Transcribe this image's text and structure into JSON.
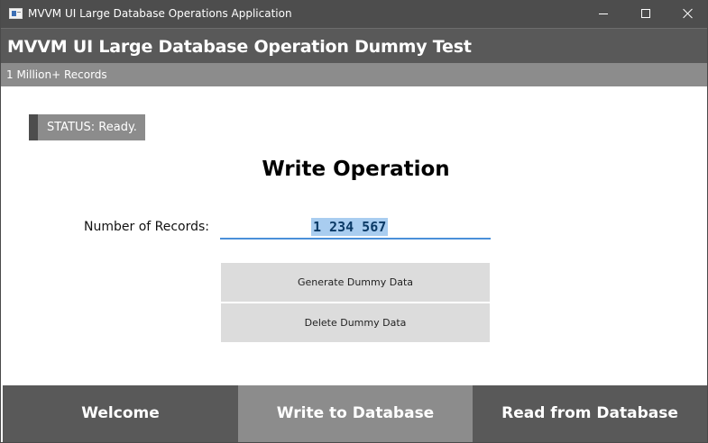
{
  "window": {
    "title": "MVVM UI Large Database Operations Application",
    "controls": {
      "minimize_icon": "minimize-icon",
      "maximize_icon": "maximize-icon",
      "close_icon": "close-icon"
    }
  },
  "header": {
    "title": "MVVM UI Large Database Operation Dummy Test",
    "subtitle": "1 Million+ Records"
  },
  "status": {
    "text": "STATUS: Ready."
  },
  "main": {
    "section_title": "Write Operation",
    "records_label": "Number of Records:",
    "records_value": "1 234 567",
    "generate_label": "Generate Dummy Data",
    "delete_label": "Delete Dummy Data"
  },
  "nav": {
    "items": [
      {
        "label": "Welcome",
        "active": false
      },
      {
        "label": "Write to Database",
        "active": true
      },
      {
        "label": "Read from Database",
        "active": false
      }
    ]
  },
  "colors": {
    "titlebar": "#4d4d4d",
    "header": "#595959",
    "subheader": "#8c8c8c",
    "input_underline": "#4a90d9",
    "selection": "#a9cdf0",
    "button": "#dcdcdc"
  }
}
